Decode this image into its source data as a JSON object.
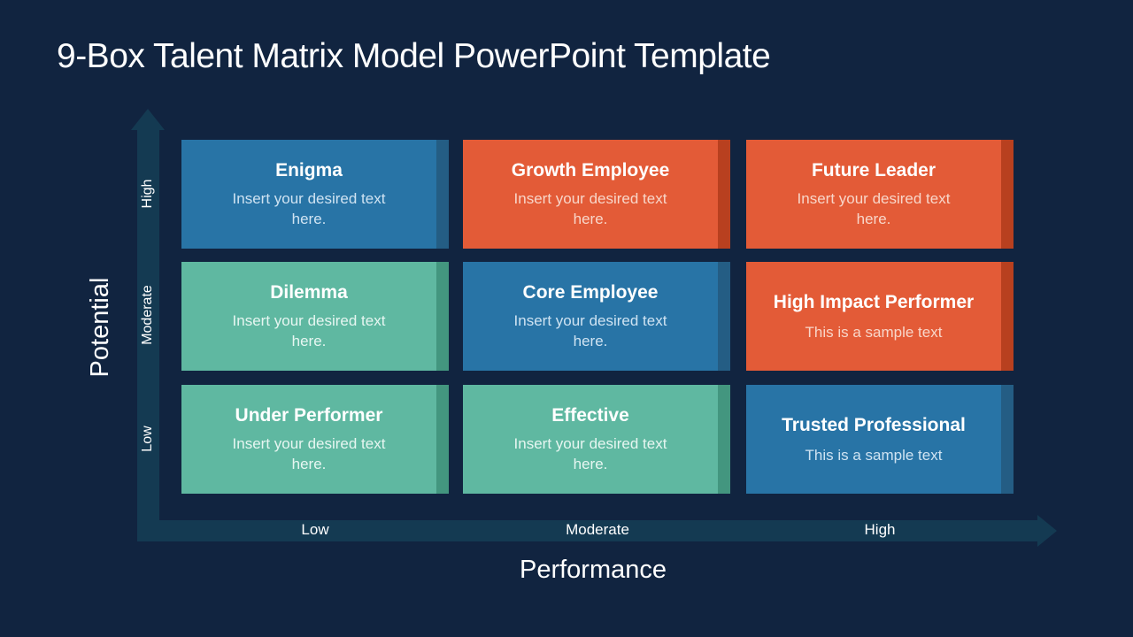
{
  "slide": {
    "title": "9-Box Talent Matrix Model PowerPoint Template"
  },
  "axes": {
    "x": {
      "title": "Performance",
      "ticks": [
        "Low",
        "Moderate",
        "High"
      ]
    },
    "y": {
      "title": "Potential",
      "ticks": [
        "Low",
        "Moderate",
        "High"
      ]
    }
  },
  "colors": {
    "background": "#112440",
    "axis": "#143a52",
    "blue": "#2874a6",
    "orange": "#e35b37",
    "teal": "#5fb8a1"
  },
  "matrix": {
    "rows": [
      {
        "potential": "High",
        "cells": [
          {
            "performance": "Low",
            "title": "Enigma",
            "text": "Insert your desired text here.",
            "color": "blue"
          },
          {
            "performance": "Moderate",
            "title": "Growth Employee",
            "text": "Insert your desired text here.",
            "color": "orange"
          },
          {
            "performance": "High",
            "title": "Future Leader",
            "text": "Insert your desired text here.",
            "color": "orange"
          }
        ]
      },
      {
        "potential": "Moderate",
        "cells": [
          {
            "performance": "Low",
            "title": "Dilemma",
            "text": "Insert your desired text here.",
            "color": "teal"
          },
          {
            "performance": "Moderate",
            "title": "Core Employee",
            "text": "Insert your desired text here.",
            "color": "blue"
          },
          {
            "performance": "High",
            "title": "High Impact Performer",
            "text": "This is a sample text",
            "color": "orange"
          }
        ]
      },
      {
        "potential": "Low",
        "cells": [
          {
            "performance": "Low",
            "title": "Under Performer",
            "text": "Insert your desired text here.",
            "color": "teal"
          },
          {
            "performance": "Moderate",
            "title": "Effective",
            "text": "Insert your desired text here.",
            "color": "teal"
          },
          {
            "performance": "High",
            "title": "Trusted Professional",
            "text": "This is a sample text",
            "color": "blue"
          }
        ]
      }
    ]
  }
}
